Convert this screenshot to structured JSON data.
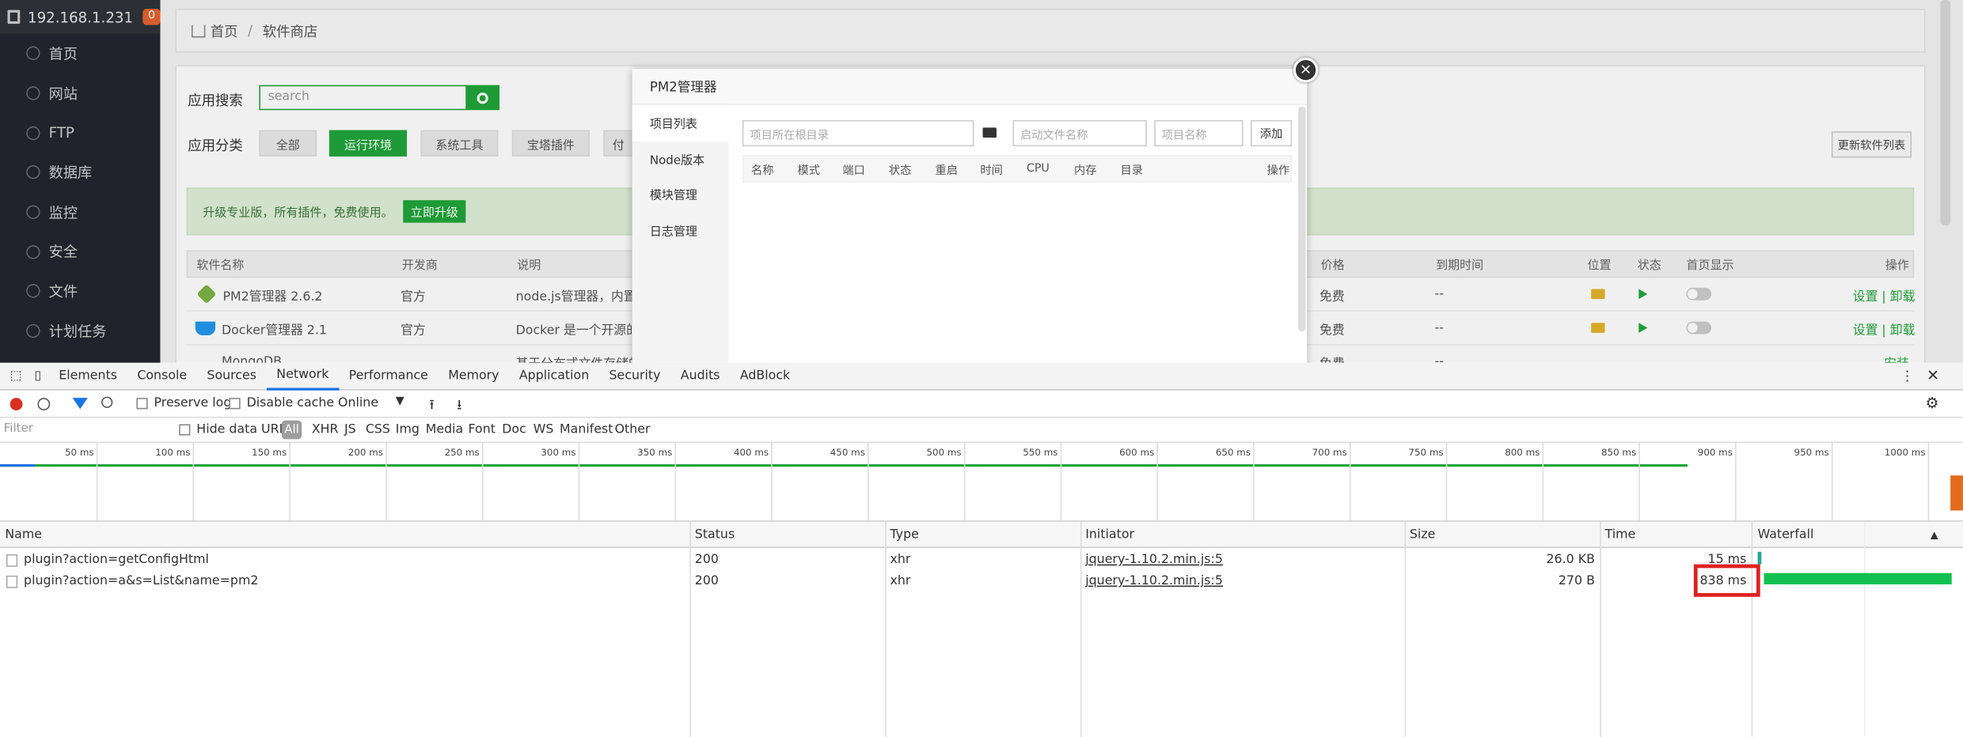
{
  "sidebar": {
    "host": "192.168.1.231",
    "badge": "0",
    "items": [
      "首页",
      "网站",
      "FTP",
      "数据库",
      "监控",
      "安全",
      "文件",
      "计划任务"
    ]
  },
  "breadcrumb": {
    "home": "首页",
    "sep": "/",
    "current": "软件商店"
  },
  "store": {
    "search_label": "应用搜索",
    "search_placeholder": "search",
    "category_label": "应用分类",
    "categories": [
      "全部",
      "运行环境",
      "系统工具",
      "宝塔插件",
      "付"
    ],
    "update_list": "更新软件列表",
    "promo_text": "升级专业版，所有插件，免费使用。",
    "promo_button": "立即升级",
    "headers": [
      "软件名称",
      "开发商",
      "说明",
      "价格",
      "到期时间",
      "位置",
      "状态",
      "首页显示",
      "操作"
    ],
    "rows": [
      {
        "name": "PM2管理器 2.6.2",
        "dev": "官方",
        "desc": "node.js管理器，内置 no",
        "price": "免费",
        "expire": "--",
        "actions": "设置 | 卸载"
      },
      {
        "name": "Docker管理器 2.1",
        "dev": "官方",
        "desc": "Docker 是一个开源的应",
        "price": "免费",
        "expire": "--",
        "actions": "设置 | 卸载"
      },
      {
        "name": "MongoDB",
        "dev": "",
        "desc": "基于分布式文件存储的数",
        "price": "免费",
        "expire": "--",
        "actions": "安装"
      }
    ]
  },
  "modal": {
    "title": "PM2管理器",
    "close": "×",
    "side": [
      "项目列表",
      "Node版本",
      "模块管理",
      "日志管理"
    ],
    "dir_placeholder": "项目所在根目录",
    "start_placeholder": "启动文件名称",
    "name_placeholder": "项目名称",
    "add": "添加",
    "columns": [
      "名称",
      "模式",
      "端口",
      "状态",
      "重启",
      "时间",
      "CPU",
      "内存",
      "目录",
      "操作"
    ]
  },
  "devtools": {
    "tabs": [
      "Elements",
      "Console",
      "Sources",
      "Network",
      "Performance",
      "Memory",
      "Application",
      "Security",
      "Audits",
      "AdBlock"
    ],
    "active_tab": "Network",
    "preserve_log": "Preserve log",
    "disable_cache": "Disable cache",
    "throttle": "Online",
    "filter_placeholder": "Filter",
    "hide_data_urls": "Hide data URLs",
    "types": [
      "All",
      "XHR",
      "JS",
      "CSS",
      "Img",
      "Media",
      "Font",
      "Doc",
      "WS",
      "Manifest",
      "Other"
    ],
    "ticks": [
      "50 ms",
      "100 ms",
      "150 ms",
      "200 ms",
      "250 ms",
      "300 ms",
      "350 ms",
      "400 ms",
      "450 ms",
      "500 ms",
      "550 ms",
      "600 ms",
      "650 ms",
      "700 ms",
      "750 ms",
      "800 ms",
      "850 ms",
      "900 ms",
      "950 ms",
      "1000 ms"
    ],
    "columns": [
      "Name",
      "Status",
      "Type",
      "Initiator",
      "Size",
      "Time",
      "Waterfall"
    ],
    "sort_indicator": "▲",
    "requests": [
      {
        "name": "plugin?action=getConfigHtml",
        "status": "200",
        "type": "xhr",
        "initiator": "jquery-1.10.2.min.js:5",
        "size": "26.0 KB",
        "time": "15 ms"
      },
      {
        "name": "plugin?action=a&s=List&name=pm2",
        "status": "200",
        "type": "xhr",
        "initiator": "jquery-1.10.2.min.js:5",
        "size": "270 B",
        "time": "838 ms"
      }
    ]
  },
  "colors": {
    "accent": "#20a53a",
    "highlight": "#e02020",
    "sidebar": "#23262e"
  }
}
